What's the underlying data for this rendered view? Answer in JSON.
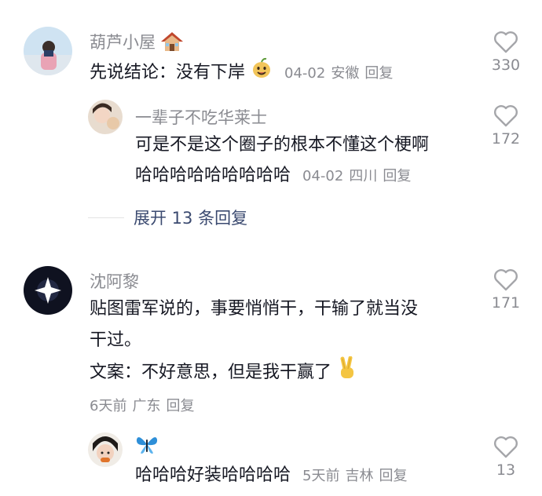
{
  "comments": [
    {
      "username": "葫芦小屋",
      "username_emoji": "house-icon",
      "text": "先说结论：没有下岸",
      "text_emoji": "pear-face-emoji",
      "date": "04-02",
      "location": "安徽",
      "reply_label": "回复",
      "likes": "330"
    },
    {
      "username": "一辈子不吃华莱士",
      "text_line1": "可是不是这个圈子的根本不懂这个梗啊",
      "text_line2": "哈哈哈哈哈哈哈哈哈",
      "date": "04-02",
      "location": "四川",
      "reply_label": "回复",
      "likes": "172"
    },
    {
      "username": "沈阿黎",
      "text_line1": "贴图雷军说的，事要悄悄干，干输了就当没",
      "text_line2": "干过。",
      "text_line3": "文案：不好意思，但是我干赢了",
      "text_emoji": "victory-hand-emoji",
      "date": "6天前",
      "location": "广东",
      "reply_label": "回复",
      "likes": "171"
    },
    {
      "username_emoji": "butterfly-icon",
      "text": "哈哈哈好装哈哈哈哈",
      "date": "5天前",
      "location": "吉林",
      "reply_label": "回复",
      "likes": "13"
    }
  ],
  "expand_replies": "展开 13 条回复",
  "colors": {
    "text": "#161823",
    "muted": "#8a8b91",
    "expand": "#3b4a70",
    "heart": "#a5a6aa"
  }
}
